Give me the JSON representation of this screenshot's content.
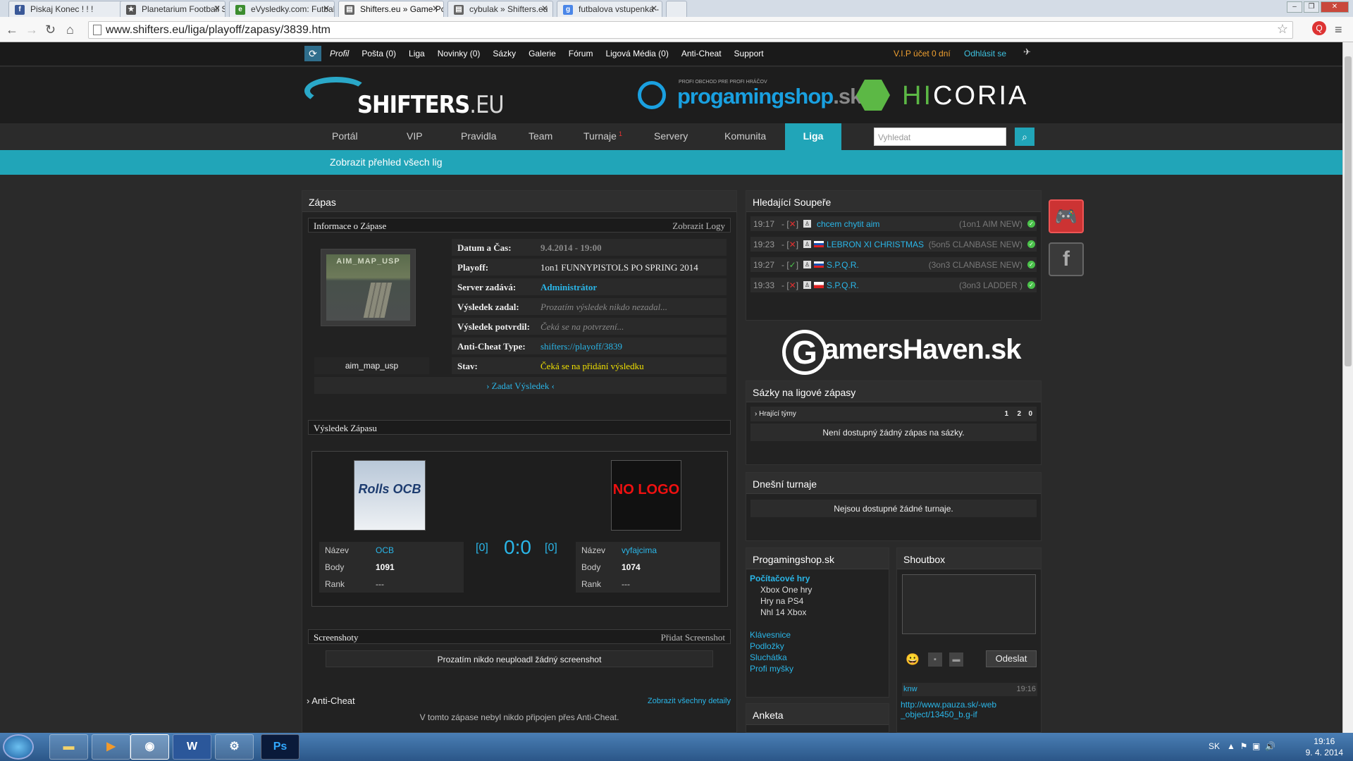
{
  "browser": {
    "tabs": [
      {
        "title": "Piskaj Konec ! ! !",
        "icon": "facebook-icon",
        "color": "#3b5998",
        "glyph": "f"
      },
      {
        "title": "Planetarium Football Star",
        "icon": "football-icon",
        "color": "#555555",
        "glyph": "★"
      },
      {
        "title": "eVysledky.com: Futbal - lä",
        "icon": "evysledky-icon",
        "color": "#3c8d2f",
        "glyph": "e"
      },
      {
        "title": "Shifters.eu » Game Portál",
        "icon": "page-icon",
        "color": "#666666",
        "glyph": "▤"
      },
      {
        "title": "cybulak » Shifters.eu",
        "icon": "page-icon",
        "color": "#666666",
        "glyph": "▤"
      },
      {
        "title": "futbalova vstupenka - Hľa",
        "icon": "google-icon",
        "color": "#4a86e8",
        "glyph": "g"
      }
    ],
    "url": "www.shifters.eu/liga/playoff/zapasy/3839.htm"
  },
  "sitetop": {
    "menu": [
      "Profil",
      "Pošta (0)",
      "Liga",
      "Novinky (0)",
      "Sázky",
      "Galerie",
      "Fórum",
      "Ligová Média (0)",
      "Anti-Cheat",
      "Support"
    ],
    "vip": "V.I.P účet 0 dní",
    "logout": "Odhlásit se"
  },
  "header": {
    "logo_text": "SHIFTERS",
    "logo_suffix": ".EU",
    "pgs_small": "PROFI OBCHOD PRE PROFI HRÁČOV",
    "pgs_name": "progamingshop",
    "pgs_tld": ".sk",
    "hic_a": "HI",
    "hic_b": "CORIA"
  },
  "nav": {
    "items": [
      "Portál",
      "VIP",
      "Pravidla",
      "Team",
      "Turnaje",
      "Servery",
      "Komunita",
      "Liga"
    ],
    "turnaje_badge": "1",
    "search_placeholder": "Vyhledat"
  },
  "subnav": {
    "link": "Zobrazit přehled všech lig"
  },
  "match": {
    "title": "Zápas",
    "info_head": "Informace o Zápase",
    "info_link": "Zobrazit Logy",
    "map_name": "aim_map_usp",
    "map_caption": "AIM_MAP_USP",
    "rows": [
      {
        "label": "Datum a Čas:",
        "value": "9.4.2014 - 19:00",
        "style": "gray-bold"
      },
      {
        "label": "Playoff:",
        "value": "1on1 FUNNYPISTOLS PO SPRING 2014",
        "style": "white"
      },
      {
        "label": "Server zadává:",
        "value": "Administrátor",
        "style": "cyan-bold"
      },
      {
        "label": "Výsledek zadal:",
        "value": "Prozatím výsledek nikdo nezadal...",
        "style": "gray-ital"
      },
      {
        "label": "Výsledek potvrdil:",
        "value": "Čeká se na potvrzení...",
        "style": "gray-ital"
      },
      {
        "label": "Anti-Cheat Type:",
        "value": "shifters://playoff/3839",
        "style": "cyan"
      },
      {
        "label": "Stav:",
        "value": "Čeká se na přidání výsledku",
        "style": "yellow"
      }
    ],
    "enter_result": "› Zadat Výsledek ‹",
    "result_head": "Výsledek Zápasu",
    "team1": {
      "logo_text": "Rolls OCB",
      "name_label": "Název",
      "name": "OCB",
      "points_label": "Body",
      "points": "1091",
      "rank_label": "Rank",
      "rank": "---"
    },
    "team2": {
      "logo_text": "NO LOGO",
      "name_label": "Název",
      "name": "vyfajcima",
      "points_label": "Body",
      "points": "1074",
      "rank_label": "Rank",
      "rank": "---"
    },
    "score": "0:0",
    "score_left": "[0]",
    "score_right": "[0]",
    "screens_head": "Screenshoty",
    "screens_link": "Přidat Screenshot",
    "screens_empty": "Prozatím nikdo neuploadl žádný screenshot",
    "ac_head": "› Anti-Cheat",
    "ac_link": "Zobrazit všechny detaily",
    "ac_text": "V tomto zápase nebyl nikdo připojen přes Anti-Cheat."
  },
  "opponents": {
    "title": "Hledající Soupeře",
    "rows": [
      {
        "time": "19:17",
        "mark": "✕",
        "mark_color": "#e03030",
        "name": "chcem chytit aim",
        "type": "(1on1 AIM NEW)"
      },
      {
        "time": "19:23",
        "mark": "✕",
        "mark_color": "#e03030",
        "name": "LEBRON XI CHRISTMAS",
        "type": "(5on5 CLANBASE NEW)"
      },
      {
        "time": "19:27",
        "mark": "✓",
        "mark_color": "#4bc24b",
        "name": "S.P.Q.R.",
        "type": "(3on3 CLANBASE NEW)"
      },
      {
        "time": "19:33",
        "mark": "✕",
        "mark_color": "#e03030",
        "name": "S.P.Q.R.",
        "type": "(3on3 LADDER )"
      }
    ]
  },
  "gamershaven": {
    "text": "amersHaven.sk",
    "g": "G"
  },
  "bets": {
    "title": "Sázky na ligové zápasy",
    "col": "› Hrající týmy",
    "c1": "1",
    "c2": "2",
    "c0": "0",
    "empty": "Není dostupný žádný zápas na sázky."
  },
  "tournaments": {
    "title": "Dnešní turnaje",
    "empty": "Nejsou dostupné žádné turnaje."
  },
  "pgshop": {
    "title": "Progamingshop.sk",
    "cat": "Počítačové hry",
    "sub": [
      "Xbox One hry",
      "Hry na PS4",
      "Nhl 14 Xbox"
    ],
    "links": [
      "Klávesnice",
      "Podložky",
      "Sluchátka",
      "Profi myšky"
    ]
  },
  "shoutbox": {
    "title": "Shoutbox",
    "send": "Odeslat",
    "user": "knw",
    "time": "19:16",
    "msg": "http://www.pauza.sk/-web_object/13450_b.g-if"
  },
  "poll": {
    "title": "Anketa"
  },
  "taskbar": {
    "lang": "SK",
    "time": "19:16",
    "date": "9. 4. 2014"
  }
}
